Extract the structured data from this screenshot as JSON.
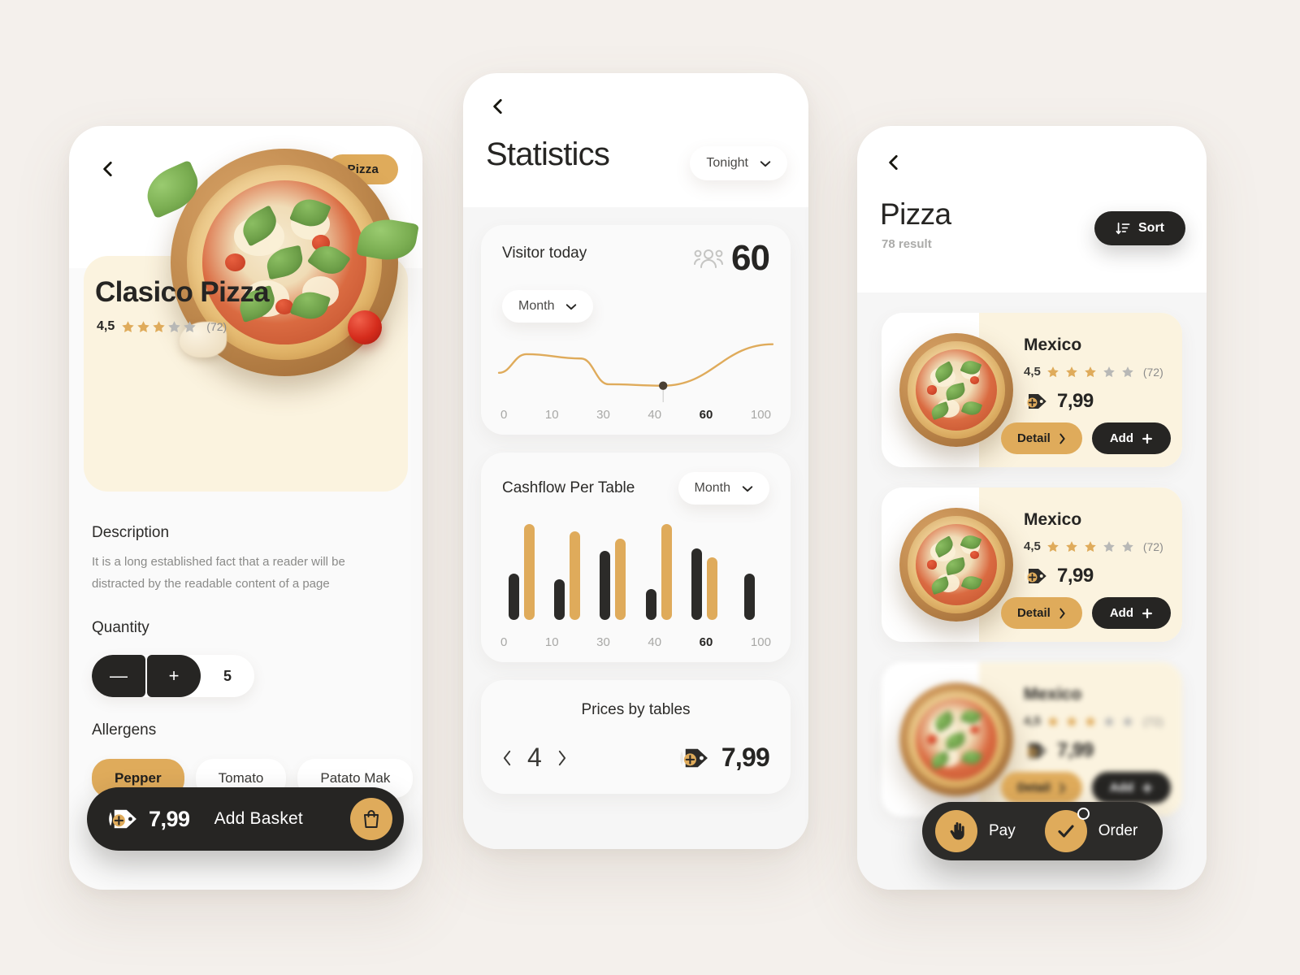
{
  "theme": {
    "background": "#F4F0EC",
    "accent_gold": "#DFAB5B",
    "dark": "#262523",
    "cream_card": "#FBF3DF",
    "star_gold": "#DFAB5B",
    "star_gray": "#B8B8B6"
  },
  "phone_detail": {
    "back_icon": "chevron-left-icon",
    "category_pill": "Pizza",
    "product_title": "Clasico Pizza",
    "rating": {
      "value": "4,5",
      "filled_stars": 3,
      "total_stars": 5,
      "count": "(72)"
    },
    "description_heading": "Description",
    "description_text": "It is a long established fact that a reader will be distracted by the readable content of a page",
    "quantity_heading": "Quantity",
    "quantity_minus": "—",
    "quantity_plus": "+",
    "quantity_value": "5",
    "allergens_heading": "Allergens",
    "allergens": [
      {
        "label": "Pepper",
        "active": true
      },
      {
        "label": "Tomato",
        "active": false
      },
      {
        "label": "Patato Mak",
        "active": false
      }
    ],
    "basket_bar": {
      "price_icon": "price-tag-icon",
      "price": "7,99",
      "label": "Add  Basket",
      "bag_icon": "shopping-bag-icon"
    }
  },
  "phone_statistics": {
    "back_icon": "chevron-left-icon",
    "title": "Statistics",
    "period_selector": {
      "value": "Tonight",
      "chevron": "chevron-down-icon"
    },
    "visitor_card": {
      "label": "Visitor today",
      "people_icon": "people-group-icon",
      "value": "60",
      "range_selector": {
        "value": "Month",
        "chevron": "chevron-down-icon"
      }
    },
    "cashflow_card": {
      "label": "Cashflow Per Table",
      "range_selector": {
        "value": "Month",
        "chevron": "chevron-down-icon"
      }
    },
    "prices_card": {
      "title": "Prices by tables",
      "prev_icon": "chevron-left-icon",
      "next_icon": "chevron-right-icon",
      "table_number": "4",
      "price_icon": "price-tag-icon",
      "price": "7,99"
    }
  },
  "phone_list": {
    "back_icon": "chevron-left-icon",
    "title": "Pizza",
    "result_count": "78 result",
    "sort_button": {
      "label": "Sort",
      "icon": "sort-descending-icon"
    },
    "items": [
      {
        "name": "Mexico",
        "rating_value": "4,5",
        "filled_stars": 3,
        "total_stars": 5,
        "rating_count": "(72)",
        "price_icon": "price-tag-icon",
        "price": "7,99",
        "detail_label": "Detail",
        "detail_icon": "chevron-right-icon",
        "add_label": "Add",
        "add_icon": "plus-icon",
        "blurred": false
      },
      {
        "name": "Mexico",
        "rating_value": "4,5",
        "filled_stars": 3,
        "total_stars": 5,
        "rating_count": "(72)",
        "price_icon": "price-tag-icon",
        "price": "7,99",
        "detail_label": "Detail",
        "detail_icon": "chevron-right-icon",
        "add_label": "Add",
        "add_icon": "plus-icon",
        "blurred": false
      },
      {
        "name": "Mexico",
        "rating_value": "4,5",
        "filled_stars": 3,
        "total_stars": 5,
        "rating_count": "(72)",
        "price_icon": "price-tag-icon",
        "price": "7,99",
        "detail_label": "Detail",
        "detail_icon": "chevron-right-icon",
        "add_label": "Add",
        "add_icon": "plus-icon",
        "blurred": true
      }
    ],
    "action_bar": {
      "pay": {
        "label": "Pay",
        "icon": "hand-icon"
      },
      "order": {
        "label": "Order",
        "icon": "check-circle-icon"
      }
    }
  },
  "chart_data": [
    {
      "type": "line",
      "title": "Visitor today",
      "xlabel": "",
      "ylabel": "",
      "categories": [
        "0",
        "10",
        "30",
        "40",
        "60",
        "100"
      ],
      "x": [
        0,
        10,
        30,
        40,
        60,
        100
      ],
      "y": [
        32,
        58,
        52,
        16,
        14,
        72
      ],
      "highlight_x": 60,
      "highlight_value": "60",
      "series": [
        {
          "name": "Visitors",
          "values": [
            32,
            58,
            52,
            16,
            14,
            72
          ],
          "color": "#DFAB5B"
        }
      ],
      "grid": false,
      "legend": "none",
      "ylim": [
        0,
        100
      ]
    },
    {
      "type": "bar",
      "title": "Cashflow Per Table",
      "xlabel": "",
      "ylabel": "",
      "categories": [
        "0",
        "10",
        "30",
        "40",
        "60",
        "100"
      ],
      "highlight_category": "60",
      "grid": false,
      "legend": "none",
      "ylim": [
        0,
        100
      ],
      "series": [
        {
          "name": "Dark",
          "color": "#2C2B29",
          "values": [
            48,
            42,
            72,
            32,
            75,
            48
          ]
        },
        {
          "name": "Gold",
          "color": "#DFAB5B",
          "values": [
            100,
            92,
            85,
            100,
            65,
            0
          ]
        }
      ]
    }
  ]
}
